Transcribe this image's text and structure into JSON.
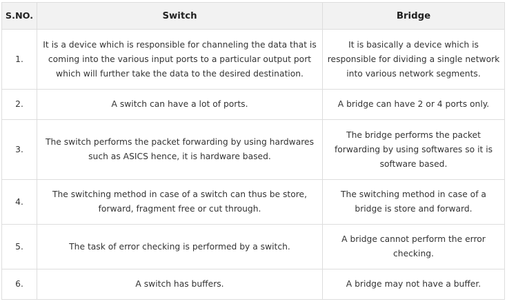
{
  "headers": [
    "S.NO.",
    "Switch",
    "Bridge"
  ],
  "rows": [
    {
      "sno": "1.",
      "switch": "It is a device which is responsible for channeling the data that is coming into the various input ports to a particular output port which will further take the data to the desired destination.",
      "bridge": "It is basically a device which is responsible for dividing a single network into various network segments."
    },
    {
      "sno": "2.",
      "switch": "A switch can have a lot of ports.",
      "bridge": "A bridge can have 2 or 4 ports only."
    },
    {
      "sno": "3.",
      "switch": "The switch performs the packet forwarding by using hardwares such as ASICS hence, it is hardware based.",
      "bridge": "The bridge performs the packet forwarding by using softwares so it is software based."
    },
    {
      "sno": "4.",
      "switch": "The switching method in case of a switch can thus be store, forward, fragment free or cut through.",
      "bridge": "The switching method in case of a bridge is store and forward."
    },
    {
      "sno": "5.",
      "switch": "The task of error checking is performed by a switch.",
      "bridge": "A bridge cannot perform the error checking."
    },
    {
      "sno": "6.",
      "switch": "A switch has buffers.",
      "bridge": "A bridge may not have a buffer."
    }
  ]
}
